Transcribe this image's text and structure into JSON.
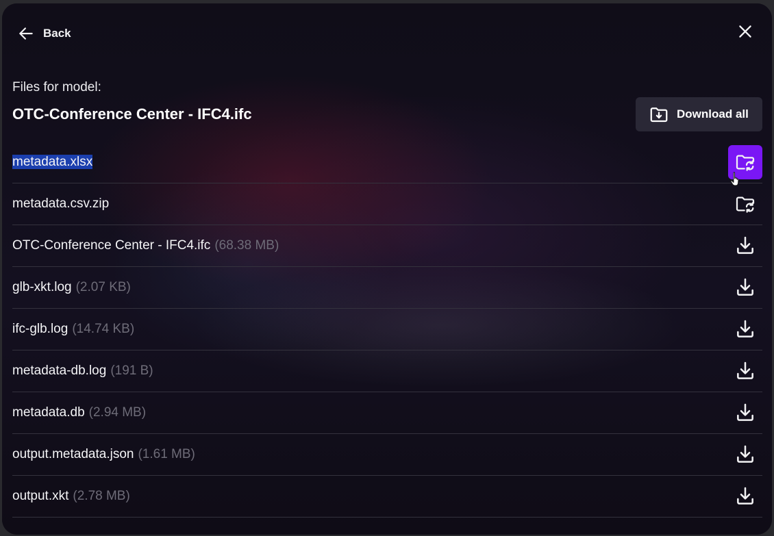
{
  "header": {
    "back_label": "Back",
    "back_icon": "arrow-left-icon",
    "close_icon": "close-icon"
  },
  "title_section": {
    "files_label": "Files for model:",
    "model_name": "OTC-Conference Center - IFC4.ifc",
    "download_all_label": "Download all",
    "download_all_icon": "folder-download-icon"
  },
  "colors": {
    "accent": "#7a17f5",
    "selection": "#1b3fae",
    "muted_text": "#6e6c78"
  },
  "files": [
    {
      "name": "metadata.xlsx",
      "size": "",
      "action_icon": "folder-sync-icon",
      "selected": true,
      "active": true
    },
    {
      "name": "metadata.csv.zip",
      "size": "",
      "action_icon": "folder-sync-icon",
      "selected": false,
      "active": false
    },
    {
      "name": "OTC-Conference Center - IFC4.ifc",
      "size": "(68.38 MB)",
      "action_icon": "download-icon",
      "selected": false,
      "active": false
    },
    {
      "name": "glb-xkt.log",
      "size": "(2.07 KB)",
      "action_icon": "download-icon",
      "selected": false,
      "active": false
    },
    {
      "name": "ifc-glb.log",
      "size": "(14.74 KB)",
      "action_icon": "download-icon",
      "selected": false,
      "active": false
    },
    {
      "name": "metadata-db.log",
      "size": "(191 B)",
      "action_icon": "download-icon",
      "selected": false,
      "active": false
    },
    {
      "name": "metadata.db",
      "size": "(2.94 MB)",
      "action_icon": "download-icon",
      "selected": false,
      "active": false
    },
    {
      "name": "output.metadata.json",
      "size": "(1.61 MB)",
      "action_icon": "download-icon",
      "selected": false,
      "active": false
    },
    {
      "name": "output.xkt",
      "size": "(2.78 MB)",
      "action_icon": "download-icon",
      "selected": false,
      "active": false
    }
  ]
}
